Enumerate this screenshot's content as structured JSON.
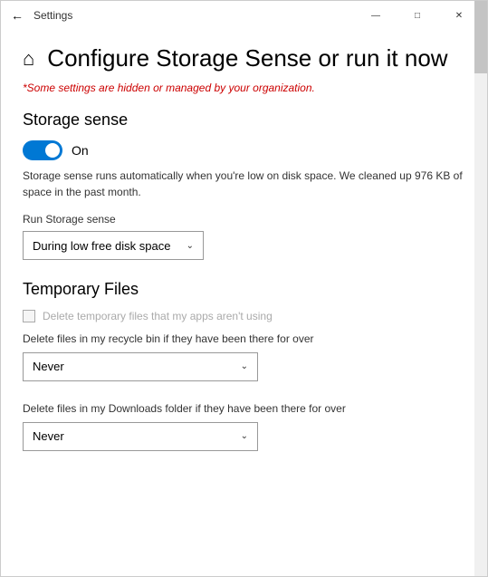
{
  "window": {
    "title": "Settings",
    "back_icon": "←",
    "minimize_icon": "—",
    "maximize_icon": "□",
    "close_icon": "✕"
  },
  "page": {
    "home_icon": "⌂",
    "title": "Configure Storage Sense or run it now",
    "org_warning": "*Some settings are hidden or managed by your organization."
  },
  "storage_sense": {
    "section_title": "Storage sense",
    "toggle_label": "On",
    "description": "Storage sense runs automatically when you're low on disk space. We cleaned up 976 KB of space in the past month.",
    "run_label": "Run Storage sense",
    "dropdown_value": "During low free disk space"
  },
  "temporary_files": {
    "section_title": "Temporary Files",
    "checkbox_label": "Delete temporary files that my apps aren't using",
    "recycle_bin_label": "Delete files in my recycle bin if they have been there for over",
    "recycle_bin_value": "Never",
    "downloads_label": "Delete files in my Downloads folder if they have been there for over",
    "downloads_value": "Never"
  }
}
